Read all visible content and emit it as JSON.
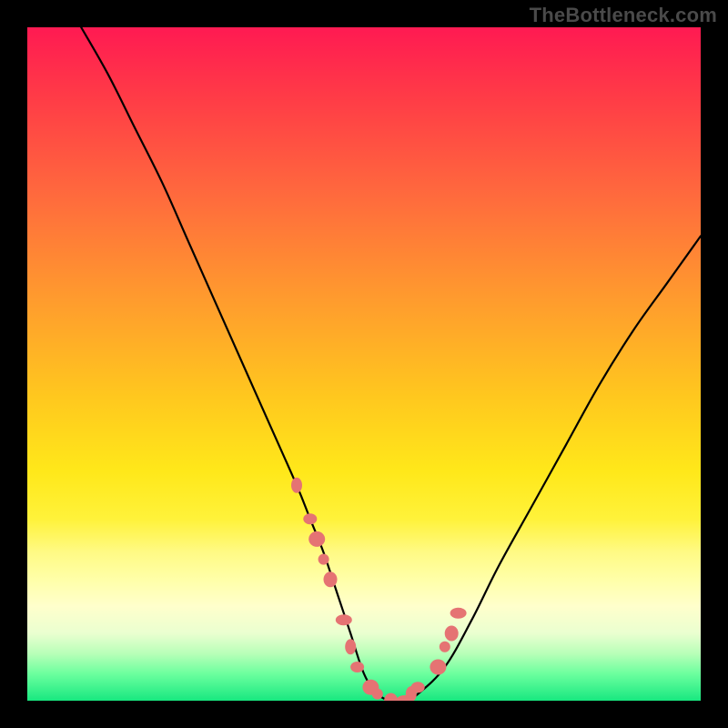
{
  "watermark": "TheBottleneck.com",
  "chart_data": {
    "type": "line",
    "title": "",
    "xlabel": "",
    "ylabel": "",
    "xlim": [
      0,
      100
    ],
    "ylim": [
      0,
      100
    ],
    "grid": false,
    "legend": false,
    "series": [
      {
        "name": "bottleneck-curve",
        "x": [
          8,
          12,
          16,
          20,
          24,
          28,
          32,
          36,
          40,
          42,
          44,
          46,
          48,
          50,
          52,
          54,
          56,
          58,
          62,
          66,
          70,
          75,
          80,
          85,
          90,
          95,
          100
        ],
        "y": [
          100,
          93,
          85,
          77,
          68,
          59,
          50,
          41,
          32,
          27,
          22,
          16,
          10,
          4,
          1,
          0,
          0,
          1,
          5,
          12,
          20,
          29,
          38,
          47,
          55,
          62,
          69
        ]
      }
    ],
    "markers": {
      "name": "data-points",
      "x": [
        40,
        42,
        43,
        44,
        45,
        47,
        48,
        49,
        51,
        52,
        54,
        56,
        57,
        58,
        61,
        62,
        63,
        64
      ],
      "y": [
        32,
        27,
        24,
        21,
        18,
        12,
        8,
        5,
        2,
        1,
        0,
        0,
        1,
        2,
        5,
        8,
        10,
        13
      ]
    },
    "background_gradient": {
      "stops": [
        {
          "pos": 0,
          "color": "#ff1a52"
        },
        {
          "pos": 25,
          "color": "#ff6a3d"
        },
        {
          "pos": 55,
          "color": "#ffc81e"
        },
        {
          "pos": 78,
          "color": "#fffa85"
        },
        {
          "pos": 100,
          "color": "#18e880"
        }
      ]
    }
  }
}
